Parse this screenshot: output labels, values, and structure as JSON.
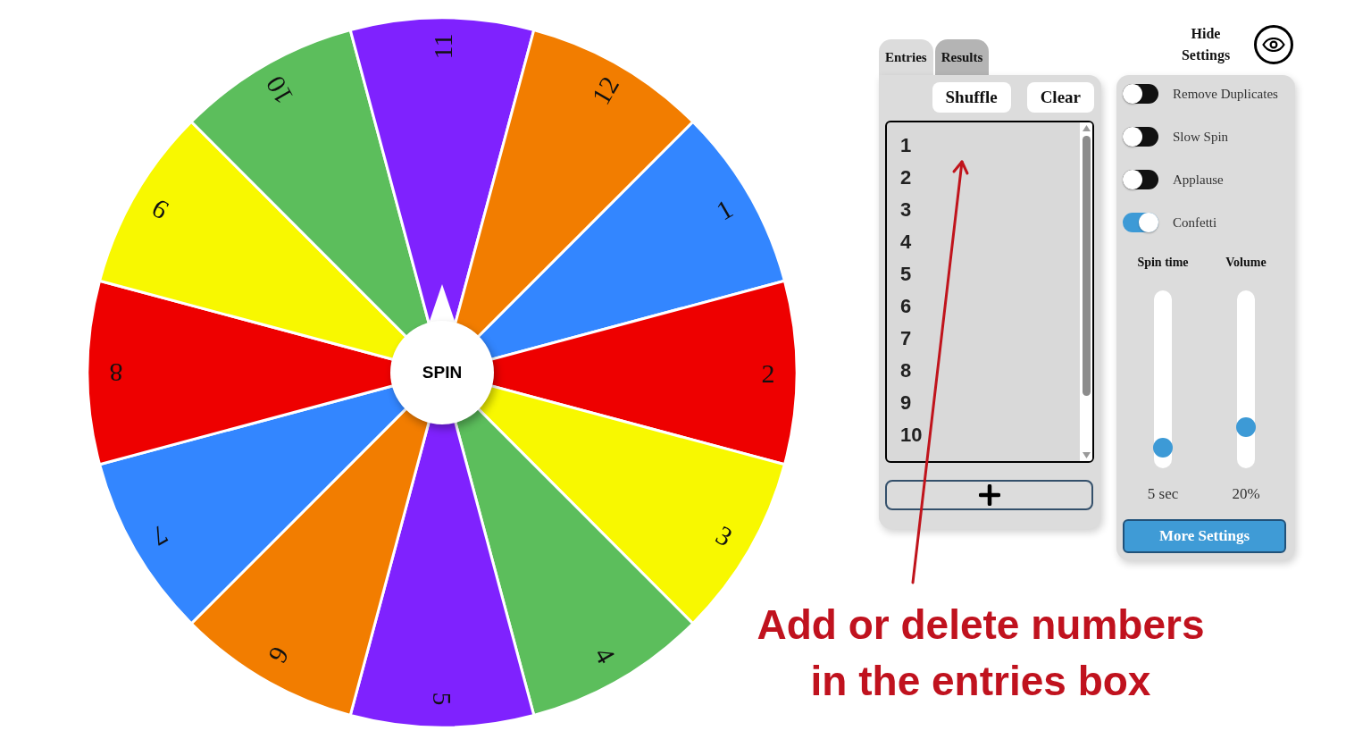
{
  "wheel": {
    "segments": [
      {
        "label": "1",
        "color": "#3386ff"
      },
      {
        "label": "2",
        "color": "#ee0000"
      },
      {
        "label": "3",
        "color": "#f8f800"
      },
      {
        "label": "4",
        "color": "#5cbe5c"
      },
      {
        "label": "5",
        "color": "#7f22fe"
      },
      {
        "label": "6",
        "color": "#f27d00"
      },
      {
        "label": "7",
        "color": "#3386ff"
      },
      {
        "label": "8",
        "color": "#ee0000"
      },
      {
        "label": "9",
        "color": "#f8f800"
      },
      {
        "label": "10",
        "color": "#5cbe5c"
      },
      {
        "label": "11",
        "color": "#7f22fe"
      },
      {
        "label": "12",
        "color": "#f27d00"
      }
    ],
    "spin_button": "SPIN"
  },
  "entries_panel": {
    "tabs": [
      {
        "label": "Entries",
        "selected": true
      },
      {
        "label": "Results",
        "selected": false
      }
    ],
    "buttons": [
      "Shuffle",
      "Clear"
    ],
    "entries": [
      "1",
      "2",
      "3",
      "4",
      "5",
      "6",
      "7",
      "8",
      "9",
      "10"
    ]
  },
  "settings": {
    "hide_label": "Hide Settings",
    "toggles": [
      {
        "label": "Remove Duplicates",
        "on": false
      },
      {
        "label": "Slow Spin",
        "on": false
      },
      {
        "label": "Applause",
        "on": false
      },
      {
        "label": "Confetti",
        "on": true
      }
    ],
    "sliders": [
      {
        "label": "Spin time",
        "level": 0.07,
        "reading": "5 sec"
      },
      {
        "label": "Volume",
        "level": 0.2,
        "reading": "20%"
      }
    ],
    "more_button": "More Settings"
  },
  "annotation": "Add or delete numbers in the entries box"
}
